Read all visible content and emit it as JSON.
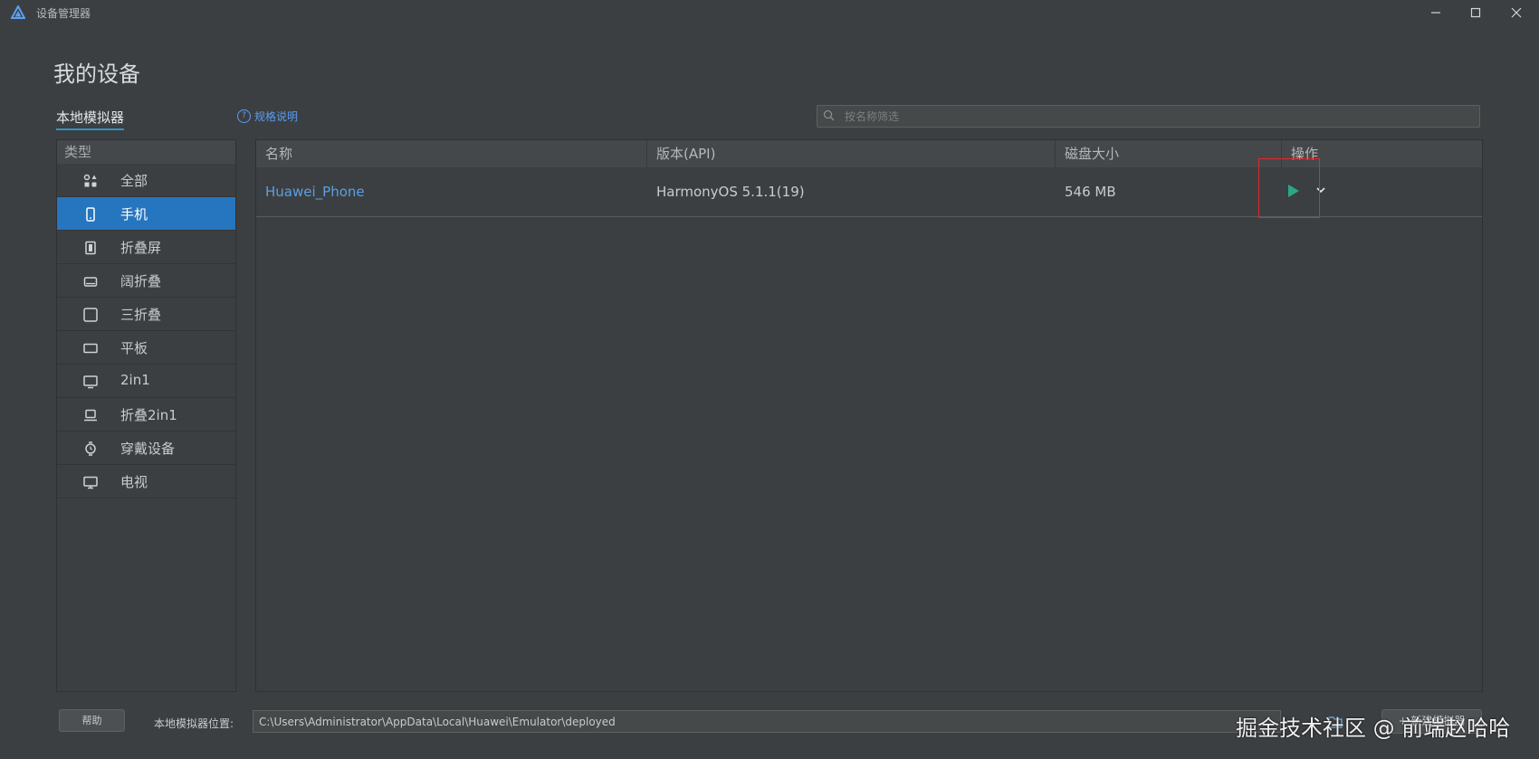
{
  "window": {
    "title": "设备管理器",
    "controls": [
      "minimize-icon",
      "maximize-icon",
      "close-icon"
    ]
  },
  "page": {
    "title": "我的设备",
    "tab_local": "本地模拟器",
    "spec_link": "规格说明"
  },
  "search": {
    "placeholder": "按名称筛选"
  },
  "sidebar": {
    "header": "类型",
    "active_index": 1,
    "items": [
      {
        "label": "全部",
        "icon": "grid-icon"
      },
      {
        "label": "手机",
        "icon": "phone-icon"
      },
      {
        "label": "折叠屏",
        "icon": "foldable-icon"
      },
      {
        "label": "阔折叠",
        "icon": "wide-fold-icon"
      },
      {
        "label": "三折叠",
        "icon": "tri-fold-icon"
      },
      {
        "label": "平板",
        "icon": "tablet-icon"
      },
      {
        "label": "2in1",
        "icon": "monitor-icon"
      },
      {
        "label": "折叠2in1",
        "icon": "laptop-icon"
      },
      {
        "label": "穿戴设备",
        "icon": "watch-icon"
      },
      {
        "label": "电视",
        "icon": "tv-icon"
      }
    ]
  },
  "table": {
    "columns": [
      "名称",
      "版本(API)",
      "磁盘大小",
      "操作"
    ],
    "rows": [
      {
        "name": "Huawei_Phone",
        "version": "HarmonyOS 5.1.1(19)",
        "disk": "546 MB"
      }
    ]
  },
  "footer": {
    "help": "帮助",
    "location_label": "本地模拟器位置:",
    "location_value": "C:\\Users\\Administrator\\AppData\\Local\\Huawei\\Emulator\\deployed",
    "create_button": "+ 新建模拟器"
  },
  "watermark": "掘金技术社区 @ 前端赵哈哈",
  "colors": {
    "background": "#3c3f41",
    "accent": "#2675bf",
    "link": "#5b9fe5",
    "play": "#2aa889",
    "highlight": "#e0282d"
  }
}
